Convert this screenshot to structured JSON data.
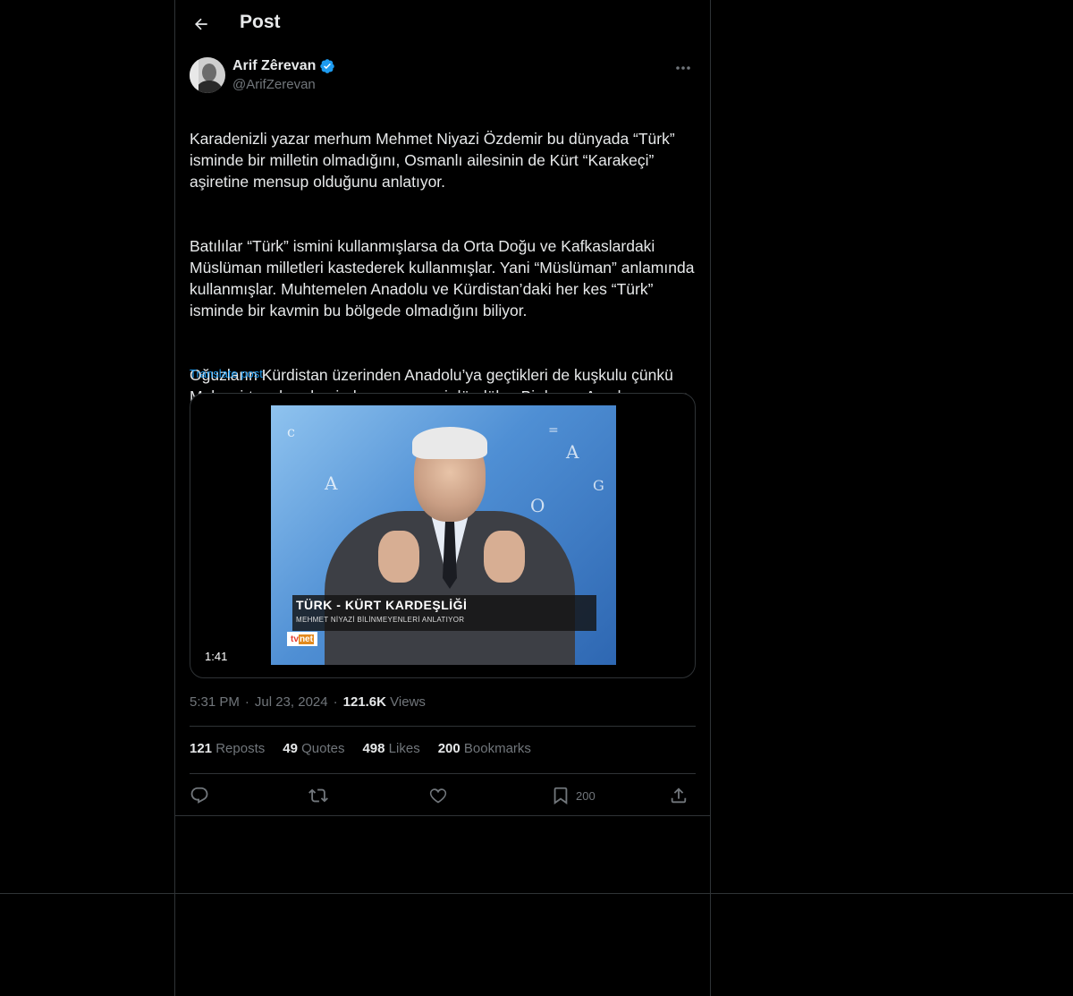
{
  "header": {
    "title": "Post"
  },
  "author": {
    "display_name": "Arif Zêrevan",
    "handle": "@ArifZerevan",
    "verified": true
  },
  "tweet": {
    "paragraphs": [
      "Karadenizli yazar merhum Mehmet Niyazi Özdemir bu dünyada “Türk” isminde bir milletin olmadığını, Osmanlı ailesinin de Kürt “Karakeçi” aşiretine mensup olduğunu anlatıyor.",
      "Batılılar “Türk” ismini kullanmışlarsa da Orta Doğu ve Kafkaslardaki Müslüman milletleri kastederek kullanmışlar. Yani “Müslüman” anlamında kullanmışlar. Muhtemelen Anadolu ve Kürdistan’daki her kes “Türk” isminde bir kavmin bu bölgede olmadığını biliyor.",
      "Oğuzların Kürdistan üzerinden Anadolu’ya geçtikleri de kuşkulu çünkü Malazgirt muharebesinden sonra geri döndüler. Bir kısmı Azerbaycan ve İran tarafında kalmış olabilir."
    ],
    "translate_label": "Translate post"
  },
  "media": {
    "duration": "1:41",
    "lower_third_title": "TÜRK - KÜRT KARDEŞLİĞİ",
    "lower_third_subtitle": "MEHMET NİYAZİ BİLİNMEYENLERİ ANLATIYOR",
    "logo_tv": "tv",
    "logo_net": "net"
  },
  "meta": {
    "time": "5:31 PM",
    "date": "Jul 23, 2024",
    "views_count": "121.6K",
    "views_label": "Views",
    "dot": "·"
  },
  "stats": {
    "reposts_count": "121",
    "reposts_label": "Reposts",
    "quotes_count": "49",
    "quotes_label": "Quotes",
    "likes_count": "498",
    "likes_label": "Likes",
    "bookmarks_count": "200",
    "bookmarks_label": "Bookmarks"
  },
  "actions": {
    "bookmark_count": "200"
  },
  "icons": {
    "back": "arrow-left-icon",
    "verified": "verified-badge-icon",
    "more": "more-horizontal-icon",
    "reply": "reply-icon",
    "repost": "repost-icon",
    "like": "heart-icon",
    "bookmark": "bookmark-icon",
    "share": "share-icon"
  },
  "colors": {
    "background": "#000000",
    "text": "#e7e9ea",
    "secondary": "#71767b",
    "accent": "#1d9bf0",
    "border": "#2f3336"
  }
}
